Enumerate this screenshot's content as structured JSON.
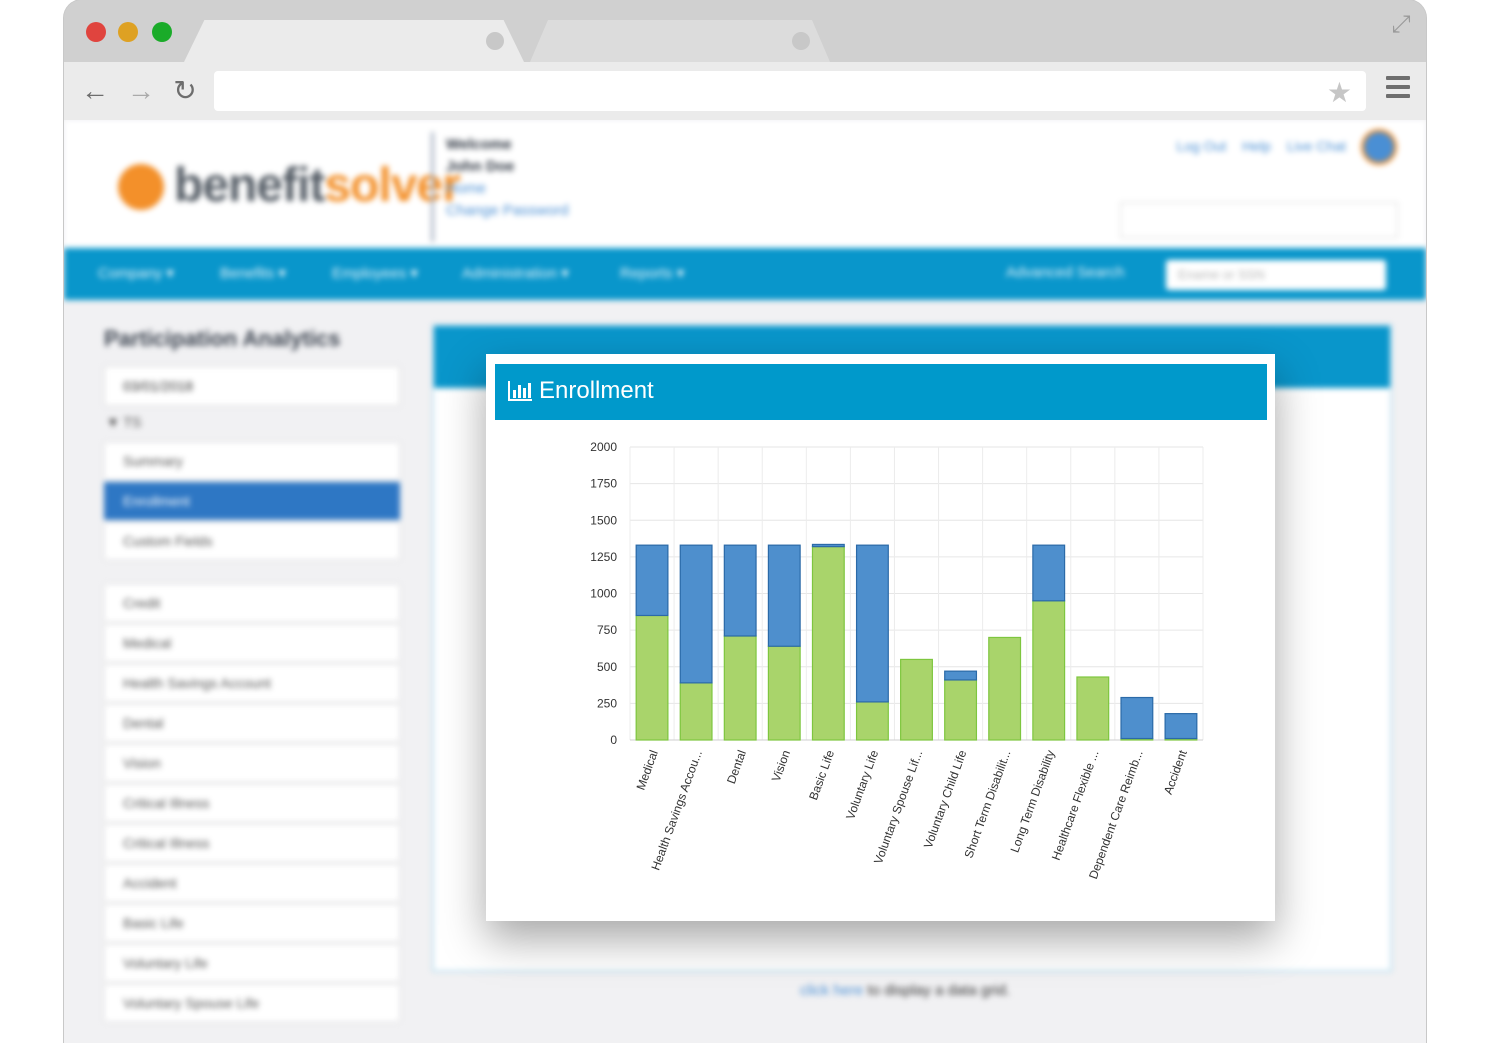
{
  "browser": {
    "address": ""
  },
  "header": {
    "logo": {
      "part1": "benefit",
      "part2": "solver"
    },
    "welcome": {
      "line1": "Welcome",
      "line2": "John Doe",
      "home_link": "Home",
      "change_password_link": "Change Password"
    },
    "top_links": [
      "Log Out",
      "Help",
      "Live Chat"
    ]
  },
  "nav": {
    "items": [
      "Company ▾",
      "Benefits ▾",
      "Employees ▾",
      "Administration ▾",
      "Reports ▾"
    ],
    "advanced_search": "Advanced Search",
    "search_placeholder": "Ename or SSN"
  },
  "sidebar": {
    "title": "Participation Analytics",
    "date_value": "03/01/2018",
    "filter_label": "▼ TS",
    "group1": [
      "Summary",
      "Enrollment",
      "Custom Fields"
    ],
    "group2": [
      "Credit",
      "Medical",
      "Health Savings Account",
      "Dental",
      "Vision",
      "Critical Illness",
      "Critical Illness",
      "Accident",
      "Basic Life",
      "Voluntary Life",
      "Voluntary Spouse Life"
    ]
  },
  "main": {
    "grid_link": "click here",
    "grid_text": " to display a data grid."
  },
  "card": {
    "title": "Enrollment"
  },
  "colors": {
    "nav_blue": "#0996cb",
    "header_blue": "#0099cb",
    "bar_green": "#a9d46b",
    "bar_green_stroke": "#7ec63f",
    "bar_blue": "#4e8fcd",
    "bar_blue_stroke": "#2b6aa8"
  },
  "chart_data": {
    "type": "bar",
    "stacked": true,
    "categories": [
      "Medical",
      "Health Savings Accou...",
      "Dental",
      "Vision",
      "Basic Life",
      "Voluntary Life",
      "Voluntary Spouse Lif...",
      "Voluntary Child Life",
      "Short Term Disabilit...",
      "Long Term Disability",
      "Healthcare Flexible ...",
      "Dependent Care Reimb...",
      "Accident"
    ],
    "series": [
      {
        "values": [
          850,
          390,
          710,
          640,
          1320,
          260,
          550,
          410,
          700,
          950,
          430,
          10,
          10
        ]
      },
      {
        "values": [
          480,
          940,
          620,
          690,
          15,
          1070,
          0,
          60,
          0,
          380,
          0,
          280,
          170
        ]
      }
    ],
    "ylim": [
      0,
      2000
    ],
    "yticks": [
      0,
      250,
      500,
      750,
      1000,
      1250,
      1500,
      1750,
      2000
    ],
    "grid": true
  }
}
